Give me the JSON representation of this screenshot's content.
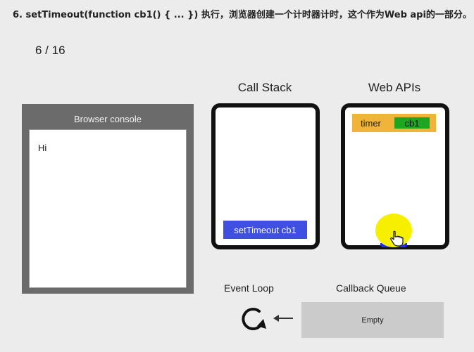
{
  "heading": "6. setTimeout(function cb1() { ... }) 执行，浏览器创建一个计时器计时，这个作为Web api的一部分。",
  "step_counter": "6 / 16",
  "console": {
    "title": "Browser console",
    "lines": [
      "Hi"
    ]
  },
  "call_stack": {
    "title": "Call Stack",
    "frames": [
      "setTimeout cb1"
    ]
  },
  "web_apis": {
    "title": "Web APIs",
    "timer_label": "timer",
    "timer_callback": "cb1"
  },
  "event_loop": {
    "title": "Event Loop",
    "icon": "refresh-loop-icon"
  },
  "callback_queue": {
    "title": "Callback Queue",
    "status": "Empty"
  },
  "colors": {
    "stack_frame": "#3f4fe0",
    "timer_bg": "#f0b43a",
    "callback_bg": "#1fa51f",
    "cursor_highlight": "#f6ef00",
    "console_frame": "#6b6b6b",
    "queue_bg": "#cbcbcb"
  }
}
